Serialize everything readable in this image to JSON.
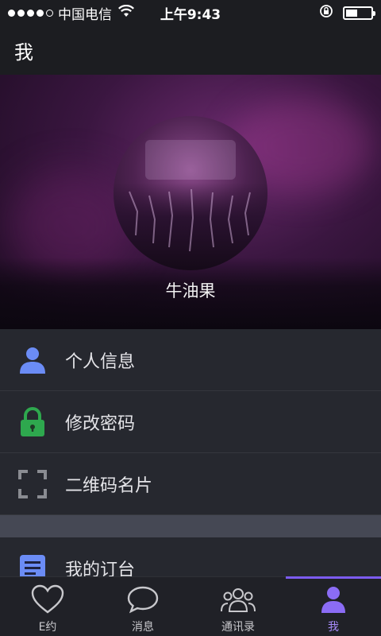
{
  "status_bar": {
    "carrier": "中国电信",
    "time": "上午9:43",
    "battery_level": 0.45
  },
  "title_bar": {
    "title": "我"
  },
  "profile": {
    "username": "牛油果"
  },
  "menu": {
    "items": [
      {
        "label": "个人信息",
        "icon": "person-icon"
      },
      {
        "label": "修改密码",
        "icon": "lock-icon"
      },
      {
        "label": "二维码名片",
        "icon": "qr-scan-icon"
      }
    ],
    "items_second_section": [
      {
        "label": "我的订台",
        "icon": "document-icon"
      }
    ]
  },
  "tabs": [
    {
      "label": "E约",
      "icon": "heart-icon",
      "active": false
    },
    {
      "label": "消息",
      "icon": "chat-bubble-icon",
      "active": false
    },
    {
      "label": "通讯录",
      "icon": "contacts-icon",
      "active": false
    },
    {
      "label": "我",
      "icon": "profile-icon",
      "active": true
    }
  ],
  "colors": {
    "accent": "#7c5cf0",
    "person_icon": "#6b8cf5",
    "lock_icon": "#2ea84e",
    "qr_icon": "#8a8c92",
    "document_icon": "#6b8cf5",
    "background": "#1e1f24"
  }
}
